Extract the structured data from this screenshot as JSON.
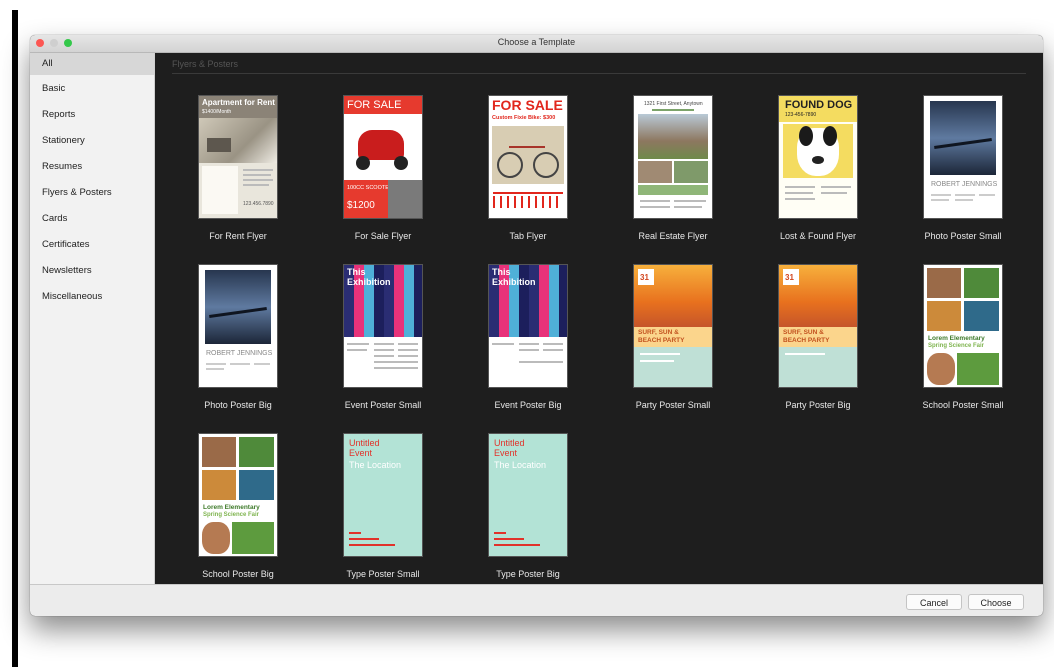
{
  "window": {
    "title": "Choose a Template"
  },
  "sidebar": {
    "items": [
      {
        "label": "All",
        "selected": true
      },
      {
        "label": "Basic"
      },
      {
        "label": "Reports"
      },
      {
        "label": "Stationery"
      },
      {
        "label": "Resumes"
      },
      {
        "label": "Flyers & Posters"
      },
      {
        "label": "Cards"
      },
      {
        "label": "Certificates"
      },
      {
        "label": "Newsletters"
      },
      {
        "label": "Miscellaneous"
      }
    ]
  },
  "main": {
    "section_title": "Flyers & Posters",
    "templates": [
      {
        "label": "For Rent Flyer",
        "thumb_text": [
          "Apartment for Rent",
          "$1400/Month",
          "123.456.7890"
        ]
      },
      {
        "label": "For Sale Flyer",
        "thumb_text": [
          "FOR SALE",
          "100CC SCOOTER",
          "$1200"
        ]
      },
      {
        "label": "Tab Flyer",
        "thumb_text": [
          "FOR SALE",
          "Custom Fixie Bike: $300"
        ]
      },
      {
        "label": "Real Estate Flyer",
        "thumb_text": [
          "1321 First Street, Anytown"
        ]
      },
      {
        "label": "Lost & Found Flyer",
        "thumb_text": [
          "FOUND DOG",
          "123-456-7890"
        ]
      },
      {
        "label": "Photo Poster Small",
        "thumb_text": [
          "ROBERT JENNINGS"
        ]
      },
      {
        "label": "Photo Poster Big",
        "thumb_text": [
          "ROBERT JENNINGS"
        ]
      },
      {
        "label": "Event Poster Small",
        "thumb_text": [
          "This",
          "Exhibition"
        ]
      },
      {
        "label": "Event Poster Big",
        "thumb_text": [
          "This",
          "Exhibition"
        ]
      },
      {
        "label": "Party Poster Small",
        "thumb_text": [
          "31",
          "SURF, SUN &",
          "BEACH PARTY"
        ]
      },
      {
        "label": "Party Poster Big",
        "thumb_text": [
          "31",
          "SURF, SUN &",
          "BEACH PARTY"
        ]
      },
      {
        "label": "School Poster Small",
        "thumb_text": [
          "Lorem Elementary",
          "Spring Science Fair"
        ]
      },
      {
        "label": "School Poster Big",
        "thumb_text": [
          "Lorem Elementary",
          "Spring Science Fair"
        ]
      },
      {
        "label": "Type Poster Small",
        "thumb_text": [
          "Untitled",
          "Event",
          "The Location"
        ]
      },
      {
        "label": "Type Poster Big",
        "thumb_text": [
          "Untitled",
          "Event",
          "The Location"
        ]
      }
    ]
  },
  "footer": {
    "cancel_label": "Cancel",
    "choose_label": "Choose"
  },
  "colors": {
    "grid_background": "#1e1e1e",
    "sidebar_background": "#f2f2f2",
    "close": "#fc5753",
    "zoom": "#34c84a"
  }
}
